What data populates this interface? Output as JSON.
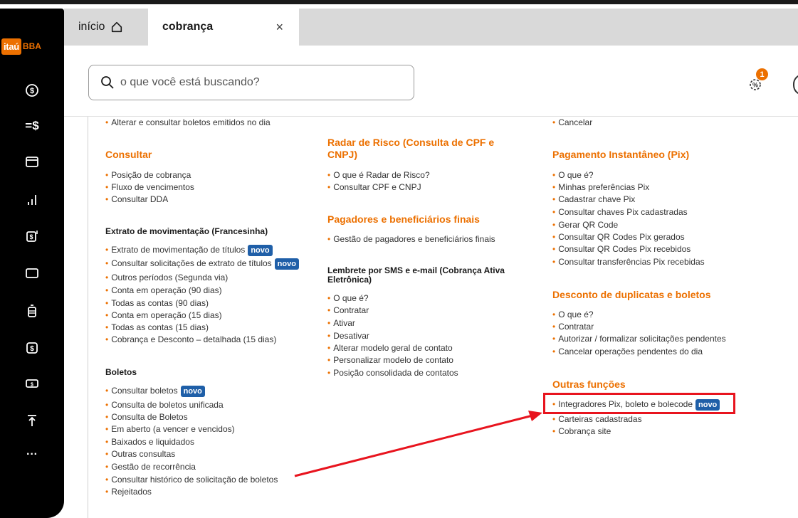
{
  "sidebar": {
    "logo_main": "itaú",
    "logo_sub": "BBA",
    "icons": [
      "dollar-icon",
      "transfer-icon",
      "wallet-icon",
      "chart-icon",
      "receipt-icon",
      "card-icon",
      "trash-icon",
      "exchange-icon",
      "cash-icon",
      "upload-icon",
      "more-icon"
    ],
    "more_label": "···",
    "transfer_label": "=$"
  },
  "tabs": {
    "home_label": "início",
    "active_label": "cobrança",
    "close_label": "×"
  },
  "header": {
    "search_placeholder": "o que você está buscando?",
    "notification_count": "1"
  },
  "col1": {
    "top_item": "Alterar e consultar boletos emitidos no dia",
    "consultar_title": "Consultar",
    "consultar_items": [
      "Posição de cobrança",
      "Fluxo de vencimentos",
      "Consultar DDA"
    ],
    "extrato_title": "Extrato de movimentação (Francesinha)",
    "extrato_items": [
      {
        "label": "Extrato de movimentação de títulos",
        "badge": "novo"
      },
      {
        "label": "Consultar solicitações de extrato de títulos",
        "badge": "novo"
      },
      {
        "label": "Outros períodos (Segunda via)",
        "badge": ""
      },
      {
        "label": "Conta em operação (90 dias)",
        "badge": ""
      },
      {
        "label": "Todas as contas (90 dias)",
        "badge": ""
      },
      {
        "label": "Conta em operação (15 dias)",
        "badge": ""
      },
      {
        "label": "Todas as contas (15 dias)",
        "badge": ""
      },
      {
        "label": "Cobrança e Desconto – detalhada (15 dias)",
        "badge": ""
      }
    ],
    "boletos_title": "Boletos",
    "boletos_items": [
      {
        "label": "Consultar boletos",
        "badge": "novo"
      },
      {
        "label": "Consulta de boletos unificada",
        "badge": ""
      },
      {
        "label": "Consulta de Boletos",
        "badge": ""
      },
      {
        "label": "Em aberto (a vencer e vencidos)",
        "badge": ""
      },
      {
        "label": "Baixados e liquidados",
        "badge": ""
      },
      {
        "label": "Outras consultas",
        "badge": ""
      },
      {
        "label": "Gestão de recorrência",
        "badge": ""
      },
      {
        "label": "Consultar histórico de solicitação de boletos",
        "badge": ""
      },
      {
        "label": "Rejeitados",
        "badge": ""
      }
    ]
  },
  "col2": {
    "radar_title_1": "Radar de Risco (Consulta de CPF e",
    "radar_title_2": "CNPJ)",
    "radar_items": [
      "O que é Radar de Risco?",
      "Consultar CPF e CNPJ"
    ],
    "pagadores_title": "Pagadores e beneficiários finais",
    "pagadores_items": [
      "Gestão de pagadores e beneficiários finais"
    ],
    "lembrete_title_1": "Lembrete por SMS e e-mail (Cobrança Ativa",
    "lembrete_title_2": "Eletrônica)",
    "lembrete_items": [
      "O que é?",
      "Contratar",
      "Ativar",
      "Desativar",
      "Alterar modelo geral de contato",
      "Personalizar modelo de contato",
      "Posição consolidada de contatos"
    ]
  },
  "col3": {
    "top_item": "Cancelar",
    "pix_title": "Pagamento Instantâneo (Pix)",
    "pix_items": [
      "O que é?",
      "Minhas preferências Pix",
      "Cadastrar chave Pix",
      "Consultar chaves Pix cadastradas",
      "Gerar QR Code",
      "Consultar QR Codes Pix gerados",
      "Consultar QR Codes Pix recebidos",
      "Consultar transferências Pix recebidas"
    ],
    "desconto_title": "Desconto de duplicatas e boletos",
    "desconto_items": [
      "O que é?",
      "Contratar",
      "Autorizar / formalizar solicitações pendentes",
      "Cancelar operações pendentes do dia"
    ],
    "outras_title": "Outras funções",
    "outras_items": [
      {
        "label": "Integradores Pix, boleto e bolecode",
        "badge": "novo"
      },
      {
        "label": "Carteiras cadastradas",
        "badge": ""
      },
      {
        "label": "Cobrança site",
        "badge": ""
      }
    ]
  },
  "colors": {
    "accent": "#ec7000",
    "badge_blue": "#1f5fa8",
    "annotation_red": "#e8141e"
  }
}
